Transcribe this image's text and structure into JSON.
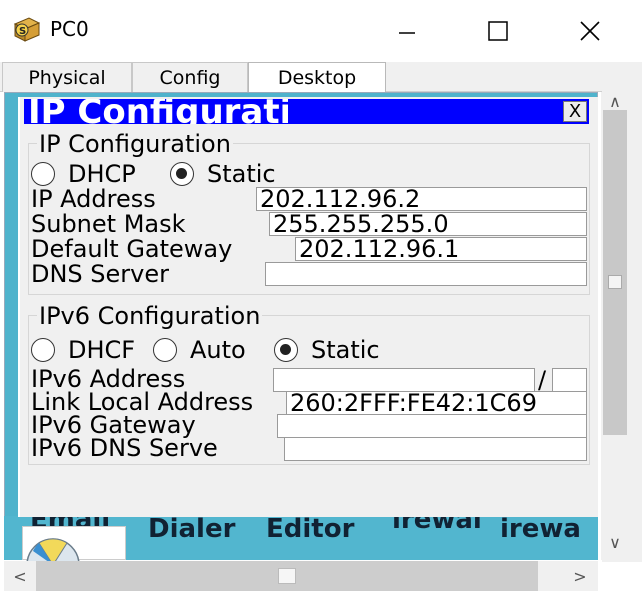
{
  "window": {
    "title": "PC0",
    "minimize": "—",
    "maximize": "☐",
    "close": "✕"
  },
  "tabs": [
    {
      "label": "Physical"
    },
    {
      "label": "Config"
    },
    {
      "label": "Desktop",
      "active": true
    }
  ],
  "desktop_apps": [
    "Email",
    "Dialer",
    "Editor",
    "irewal",
    "irewa"
  ],
  "ip_window": {
    "title": "IP Configuratic",
    "close_label": "X",
    "ipv4": {
      "group_title": "IP Configuration",
      "dhcp_label": "DHCP",
      "static_label": "Static",
      "mode": "static",
      "fields": {
        "ip_label": "IP Address",
        "ip_value": "202.112.96.2",
        "mask_label": "Subnet Mask",
        "mask_value": "255.255.255.0",
        "gw_label": "Default Gateway",
        "gw_value": "202.112.96.1",
        "dns_label": "DNS Server",
        "dns_value": ""
      }
    },
    "ipv6": {
      "group_title": "IPv6 Configuration",
      "dhcp_label": "DHCF",
      "auto_label": "Auto",
      "static_label": "Static",
      "mode": "static",
      "fields": {
        "addr_label": "IPv6 Address",
        "addr_value": "",
        "prefix_sep": "/",
        "prefix_value": "",
        "link_label": "Link Local Address",
        "link_value": "260:2FFF:FE42:1C69",
        "gw_label": "IPv6 Gateway",
        "gw_value": "",
        "dns_label": "IPv6 DNS Serve",
        "dns_value": ""
      }
    }
  },
  "scroll": {
    "up": "∧",
    "down": "∨",
    "left": "<",
    "right": ">"
  }
}
